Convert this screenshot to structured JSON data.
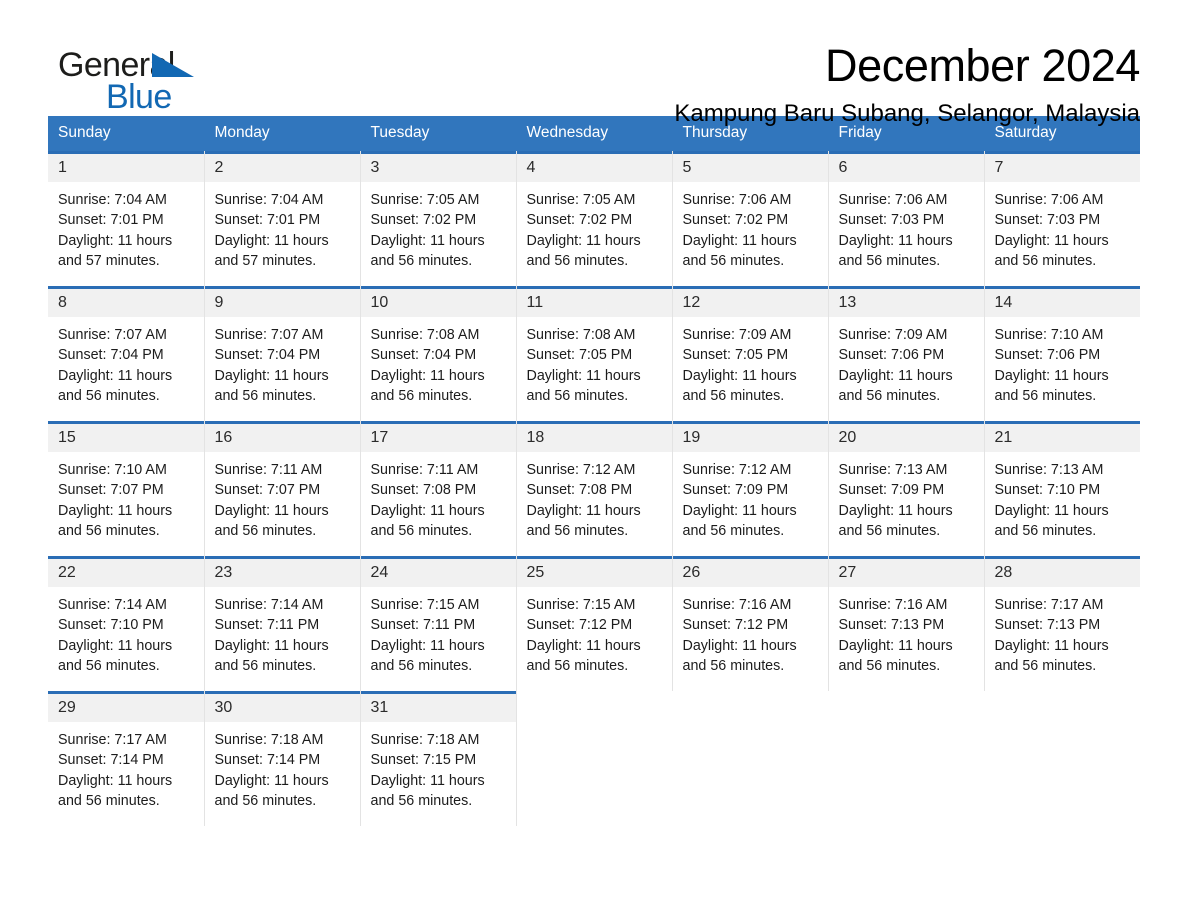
{
  "brand": {
    "name_first": "General",
    "name_second": "Blue",
    "triangle_color": "#1268b3",
    "text_color": "#1d1d1b"
  },
  "header": {
    "month_title": "December 2024",
    "location": "Kampung Baru Subang, Selangor, Malaysia"
  },
  "theme": {
    "header_blue": "#3176bd",
    "row_rule_blue": "#2a6db5",
    "daynum_bg": "#f1f1f1"
  },
  "weekday_headers": [
    "Sunday",
    "Monday",
    "Tuesday",
    "Wednesday",
    "Thursday",
    "Friday",
    "Saturday"
  ],
  "labels": {
    "sunrise_prefix": "Sunrise:",
    "sunset_prefix": "Sunset:",
    "daylight_prefix": "Daylight:"
  },
  "weeks": [
    [
      {
        "day": "1",
        "sunrise": "Sunrise: 7:04 AM",
        "sunset": "Sunset: 7:01 PM",
        "daylight_1": "Daylight: 11 hours",
        "daylight_2": "and 57 minutes."
      },
      {
        "day": "2",
        "sunrise": "Sunrise: 7:04 AM",
        "sunset": "Sunset: 7:01 PM",
        "daylight_1": "Daylight: 11 hours",
        "daylight_2": "and 57 minutes."
      },
      {
        "day": "3",
        "sunrise": "Sunrise: 7:05 AM",
        "sunset": "Sunset: 7:02 PM",
        "daylight_1": "Daylight: 11 hours",
        "daylight_2": "and 56 minutes."
      },
      {
        "day": "4",
        "sunrise": "Sunrise: 7:05 AM",
        "sunset": "Sunset: 7:02 PM",
        "daylight_1": "Daylight: 11 hours",
        "daylight_2": "and 56 minutes."
      },
      {
        "day": "5",
        "sunrise": "Sunrise: 7:06 AM",
        "sunset": "Sunset: 7:02 PM",
        "daylight_1": "Daylight: 11 hours",
        "daylight_2": "and 56 minutes."
      },
      {
        "day": "6",
        "sunrise": "Sunrise: 7:06 AM",
        "sunset": "Sunset: 7:03 PM",
        "daylight_1": "Daylight: 11 hours",
        "daylight_2": "and 56 minutes."
      },
      {
        "day": "7",
        "sunrise": "Sunrise: 7:06 AM",
        "sunset": "Sunset: 7:03 PM",
        "daylight_1": "Daylight: 11 hours",
        "daylight_2": "and 56 minutes."
      }
    ],
    [
      {
        "day": "8",
        "sunrise": "Sunrise: 7:07 AM",
        "sunset": "Sunset: 7:04 PM",
        "daylight_1": "Daylight: 11 hours",
        "daylight_2": "and 56 minutes."
      },
      {
        "day": "9",
        "sunrise": "Sunrise: 7:07 AM",
        "sunset": "Sunset: 7:04 PM",
        "daylight_1": "Daylight: 11 hours",
        "daylight_2": "and 56 minutes."
      },
      {
        "day": "10",
        "sunrise": "Sunrise: 7:08 AM",
        "sunset": "Sunset: 7:04 PM",
        "daylight_1": "Daylight: 11 hours",
        "daylight_2": "and 56 minutes."
      },
      {
        "day": "11",
        "sunrise": "Sunrise: 7:08 AM",
        "sunset": "Sunset: 7:05 PM",
        "daylight_1": "Daylight: 11 hours",
        "daylight_2": "and 56 minutes."
      },
      {
        "day": "12",
        "sunrise": "Sunrise: 7:09 AM",
        "sunset": "Sunset: 7:05 PM",
        "daylight_1": "Daylight: 11 hours",
        "daylight_2": "and 56 minutes."
      },
      {
        "day": "13",
        "sunrise": "Sunrise: 7:09 AM",
        "sunset": "Sunset: 7:06 PM",
        "daylight_1": "Daylight: 11 hours",
        "daylight_2": "and 56 minutes."
      },
      {
        "day": "14",
        "sunrise": "Sunrise: 7:10 AM",
        "sunset": "Sunset: 7:06 PM",
        "daylight_1": "Daylight: 11 hours",
        "daylight_2": "and 56 minutes."
      }
    ],
    [
      {
        "day": "15",
        "sunrise": "Sunrise: 7:10 AM",
        "sunset": "Sunset: 7:07 PM",
        "daylight_1": "Daylight: 11 hours",
        "daylight_2": "and 56 minutes."
      },
      {
        "day": "16",
        "sunrise": "Sunrise: 7:11 AM",
        "sunset": "Sunset: 7:07 PM",
        "daylight_1": "Daylight: 11 hours",
        "daylight_2": "and 56 minutes."
      },
      {
        "day": "17",
        "sunrise": "Sunrise: 7:11 AM",
        "sunset": "Sunset: 7:08 PM",
        "daylight_1": "Daylight: 11 hours",
        "daylight_2": "and 56 minutes."
      },
      {
        "day": "18",
        "sunrise": "Sunrise: 7:12 AM",
        "sunset": "Sunset: 7:08 PM",
        "daylight_1": "Daylight: 11 hours",
        "daylight_2": "and 56 minutes."
      },
      {
        "day": "19",
        "sunrise": "Sunrise: 7:12 AM",
        "sunset": "Sunset: 7:09 PM",
        "daylight_1": "Daylight: 11 hours",
        "daylight_2": "and 56 minutes."
      },
      {
        "day": "20",
        "sunrise": "Sunrise: 7:13 AM",
        "sunset": "Sunset: 7:09 PM",
        "daylight_1": "Daylight: 11 hours",
        "daylight_2": "and 56 minutes."
      },
      {
        "day": "21",
        "sunrise": "Sunrise: 7:13 AM",
        "sunset": "Sunset: 7:10 PM",
        "daylight_1": "Daylight: 11 hours",
        "daylight_2": "and 56 minutes."
      }
    ],
    [
      {
        "day": "22",
        "sunrise": "Sunrise: 7:14 AM",
        "sunset": "Sunset: 7:10 PM",
        "daylight_1": "Daylight: 11 hours",
        "daylight_2": "and 56 minutes."
      },
      {
        "day": "23",
        "sunrise": "Sunrise: 7:14 AM",
        "sunset": "Sunset: 7:11 PM",
        "daylight_1": "Daylight: 11 hours",
        "daylight_2": "and 56 minutes."
      },
      {
        "day": "24",
        "sunrise": "Sunrise: 7:15 AM",
        "sunset": "Sunset: 7:11 PM",
        "daylight_1": "Daylight: 11 hours",
        "daylight_2": "and 56 minutes."
      },
      {
        "day": "25",
        "sunrise": "Sunrise: 7:15 AM",
        "sunset": "Sunset: 7:12 PM",
        "daylight_1": "Daylight: 11 hours",
        "daylight_2": "and 56 minutes."
      },
      {
        "day": "26",
        "sunrise": "Sunrise: 7:16 AM",
        "sunset": "Sunset: 7:12 PM",
        "daylight_1": "Daylight: 11 hours",
        "daylight_2": "and 56 minutes."
      },
      {
        "day": "27",
        "sunrise": "Sunrise: 7:16 AM",
        "sunset": "Sunset: 7:13 PM",
        "daylight_1": "Daylight: 11 hours",
        "daylight_2": "and 56 minutes."
      },
      {
        "day": "28",
        "sunrise": "Sunrise: 7:17 AM",
        "sunset": "Sunset: 7:13 PM",
        "daylight_1": "Daylight: 11 hours",
        "daylight_2": "and 56 minutes."
      }
    ],
    [
      {
        "day": "29",
        "sunrise": "Sunrise: 7:17 AM",
        "sunset": "Sunset: 7:14 PM",
        "daylight_1": "Daylight: 11 hours",
        "daylight_2": "and 56 minutes."
      },
      {
        "day": "30",
        "sunrise": "Sunrise: 7:18 AM",
        "sunset": "Sunset: 7:14 PM",
        "daylight_1": "Daylight: 11 hours",
        "daylight_2": "and 56 minutes."
      },
      {
        "day": "31",
        "sunrise": "Sunrise: 7:18 AM",
        "sunset": "Sunset: 7:15 PM",
        "daylight_1": "Daylight: 11 hours",
        "daylight_2": "and 56 minutes."
      },
      {
        "day": "",
        "sunrise": "",
        "sunset": "",
        "daylight_1": "",
        "daylight_2": "",
        "blank": true
      },
      {
        "day": "",
        "sunrise": "",
        "sunset": "",
        "daylight_1": "",
        "daylight_2": "",
        "blank": true
      },
      {
        "day": "",
        "sunrise": "",
        "sunset": "",
        "daylight_1": "",
        "daylight_2": "",
        "blank": true
      },
      {
        "day": "",
        "sunrise": "",
        "sunset": "",
        "daylight_1": "",
        "daylight_2": "",
        "blank": true
      }
    ]
  ]
}
